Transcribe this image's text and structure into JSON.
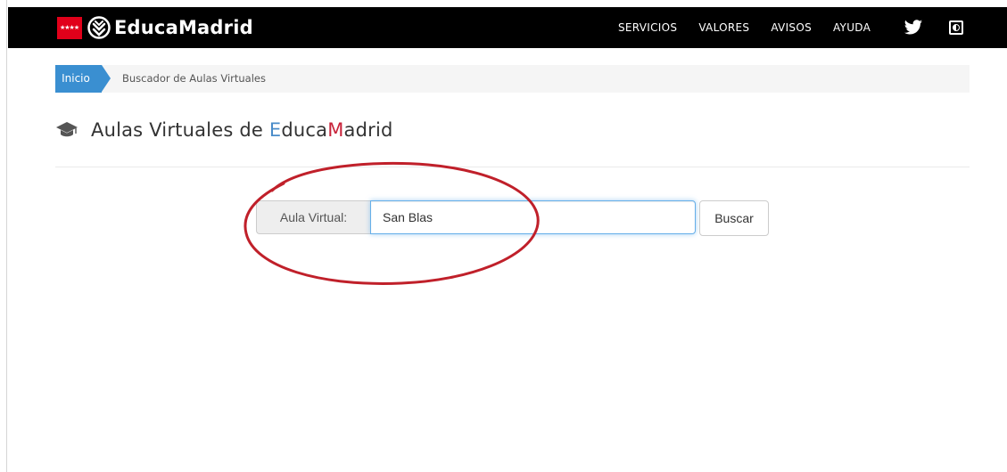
{
  "header": {
    "logo_text": "EducaMadrid",
    "nav": [
      "SERVICIOS",
      "VALORES",
      "AVISOS",
      "AYUDA"
    ],
    "icons": [
      "madrid-flag-icon",
      "educamadrid-logo-icon",
      "twitter-icon",
      "contrast-icon"
    ],
    "background_color": "#000000"
  },
  "breadcrumb": {
    "home": "Inicio",
    "current": "Buscador de Aulas Virtuales",
    "home_color": "#3a8fd1"
  },
  "page": {
    "title_prefix": "Aulas Virtuales de ",
    "title_e": "E",
    "title_duca": "duca",
    "title_m": "M",
    "title_adrid": "adrid",
    "title_icon": "graduation-cap-icon",
    "accent_e_color": "#4a8cc9",
    "accent_m_color": "#c8233a"
  },
  "search": {
    "label": "Aula Virtual:",
    "value": "San Blas",
    "button_label": "Buscar"
  },
  "annotation": {
    "shape": "ellipse",
    "color": "#c0202a"
  }
}
